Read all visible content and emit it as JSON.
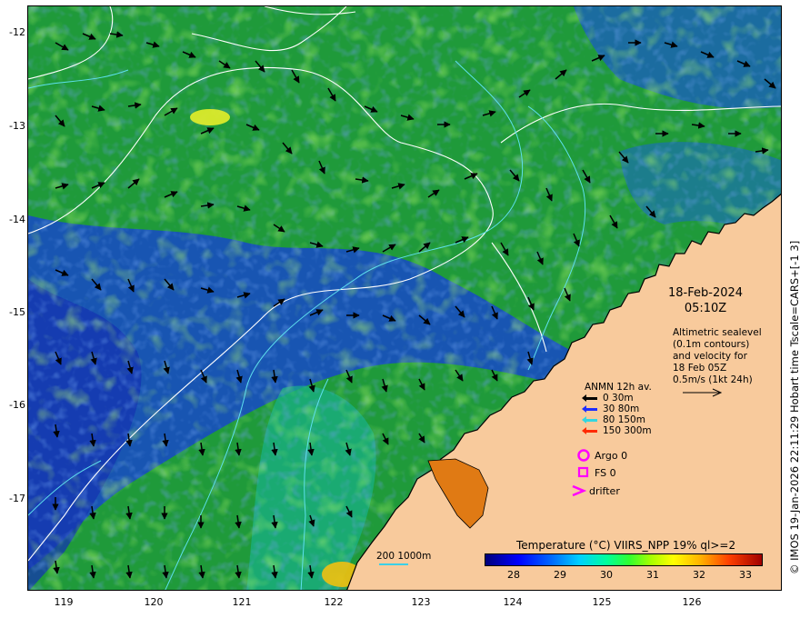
{
  "axes": {
    "lat_ticks": [
      "-12",
      "-13",
      "-14",
      "-15",
      "-16",
      "-17"
    ],
    "lon_ticks": [
      "119",
      "120",
      "121",
      "122",
      "123",
      "124",
      "125",
      "126"
    ]
  },
  "annotation": {
    "date": "18-Feb-2024",
    "time": "05:10Z",
    "altimetry": [
      "Altimetric sealevel",
      "(0.1m contours)",
      "and velocity for",
      "18 Feb 05Z",
      "0.5m/s (1kt 24h)"
    ]
  },
  "legend": {
    "title": "ANMN 12h av.",
    "entries": [
      {
        "label": "0 30m",
        "color": "#000000"
      },
      {
        "label": "30 80m",
        "color": "#1e2cff"
      },
      {
        "label": "80 150m",
        "color": "#33d6e0"
      },
      {
        "label": "150 300m",
        "color": "#ff2a00"
      }
    ],
    "argo": "Argo 0",
    "fs": "FS 0",
    "drifter": "drifter",
    "symbol_color": "#ff00ff"
  },
  "colorbar": {
    "title": "Temperature (°C) VIIRS_NPP 19% ql>=2",
    "ticks": [
      "28",
      "29",
      "30",
      "31",
      "32",
      "33"
    ]
  },
  "scale": {
    "label": "200 1000m"
  },
  "credit": "© IMOS 19-Jan-2026 22:11:29 Hobart time Tscale=CARS+[-1 3]",
  "colors": {
    "land": "#f8ca9c",
    "coast": "#000000",
    "contour": "#ffffff",
    "isobath": "#66e0ee"
  }
}
